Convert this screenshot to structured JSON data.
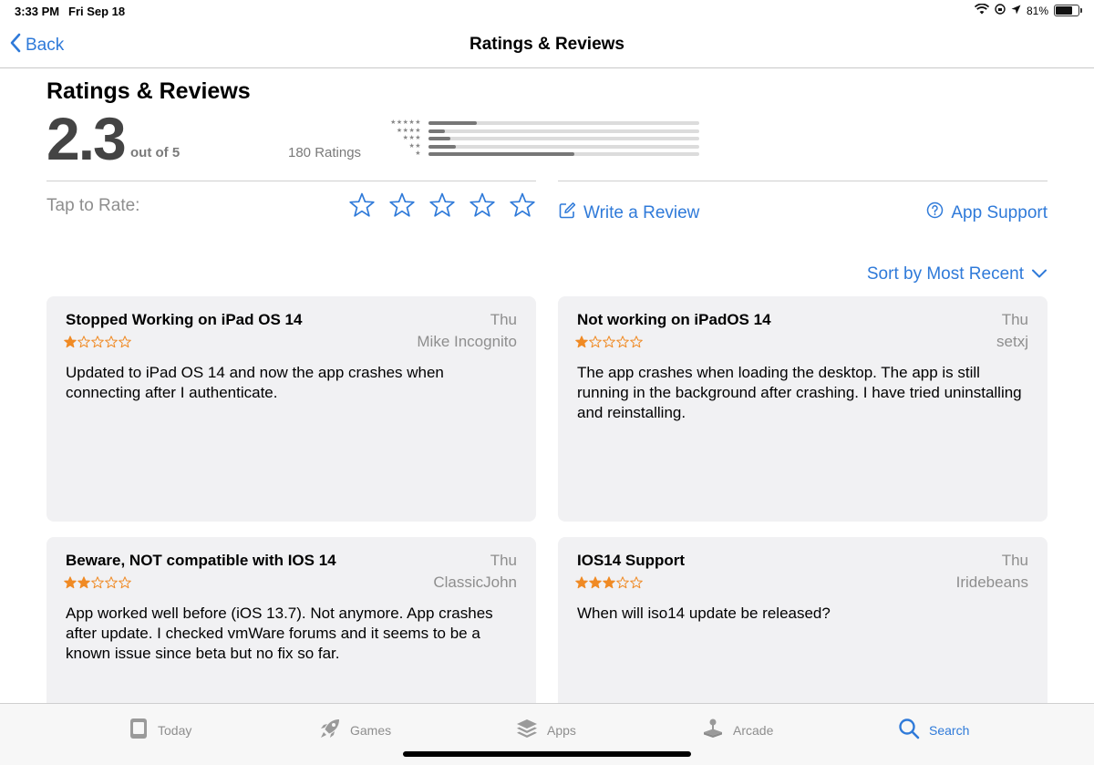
{
  "status": {
    "time": "3:33 PM",
    "date": "Fri Sep 18",
    "battery": "81%",
    "battery_level": 0.81
  },
  "nav": {
    "back_label": "Back",
    "title": "Ratings & Reviews"
  },
  "summary": {
    "title": "Ratings & Reviews",
    "rating": "2.3",
    "out_of": "out of 5",
    "count": "180 Ratings",
    "distribution": [
      {
        "stars": 5,
        "fraction": 0.18
      },
      {
        "stars": 4,
        "fraction": 0.06
      },
      {
        "stars": 3,
        "fraction": 0.08
      },
      {
        "stars": 2,
        "fraction": 0.1
      },
      {
        "stars": 1,
        "fraction": 0.54
      }
    ]
  },
  "rate": {
    "label": "Tap to Rate:"
  },
  "actions": {
    "write_review": "Write a Review",
    "app_support": "App Support"
  },
  "sort": {
    "label": "Sort by Most Recent"
  },
  "reviews": [
    {
      "title": "Stopped Working on iPad OS 14",
      "date": "Thu",
      "author": "Mike Incognito",
      "stars": 1,
      "body": "Updated to iPad OS 14 and now the app crashes when connecting after I authenticate."
    },
    {
      "title": "Not working on iPadOS 14",
      "date": "Thu",
      "author": "setxj",
      "stars": 1,
      "body": "The app crashes when loading the desktop. The app is still running in the background after crashing. I have tried uninstalling and reinstalling."
    },
    {
      "title": "Beware, NOT compatible with IOS 14",
      "date": "Thu",
      "author": "ClassicJohn",
      "stars": 2,
      "body": "App worked well before (iOS 13.7). Not anymore. App crashes after update. I checked vmWare forums and it seems to be a known issue since beta but no fix so far."
    },
    {
      "title": "IOS14 Support",
      "date": "Thu",
      "author": "Iridebeans",
      "stars": 3,
      "body": "When will iso14 update be released?"
    }
  ],
  "tabs": [
    {
      "label": "Today",
      "icon": "today-icon",
      "active": false
    },
    {
      "label": "Games",
      "icon": "rocket-icon",
      "active": false
    },
    {
      "label": "Apps",
      "icon": "layers-icon",
      "active": false
    },
    {
      "label": "Arcade",
      "icon": "joystick-icon",
      "active": false
    },
    {
      "label": "Search",
      "icon": "search-icon",
      "active": true
    }
  ],
  "colors": {
    "accent": "#2f7ad9",
    "star_orange": "#f08a24"
  }
}
